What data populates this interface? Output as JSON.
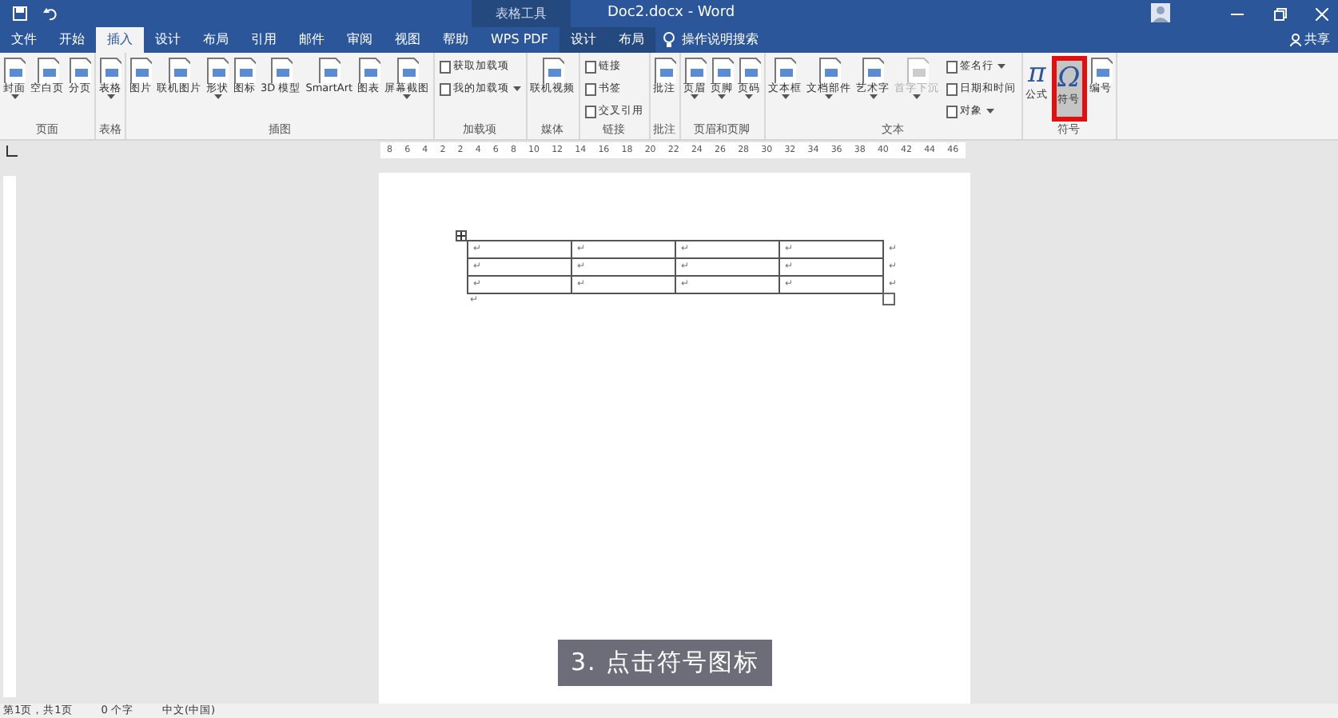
{
  "window": {
    "title": "Doc2.docx - Word",
    "context_label": "表格工具"
  },
  "tabs": [
    {
      "label": "文件",
      "selected": false,
      "context": false
    },
    {
      "label": "开始",
      "selected": false,
      "context": false
    },
    {
      "label": "插入",
      "selected": true,
      "context": false
    },
    {
      "label": "设计",
      "selected": false,
      "context": false
    },
    {
      "label": "布局",
      "selected": false,
      "context": false
    },
    {
      "label": "引用",
      "selected": false,
      "context": false
    },
    {
      "label": "邮件",
      "selected": false,
      "context": false
    },
    {
      "label": "审阅",
      "selected": false,
      "context": false
    },
    {
      "label": "视图",
      "selected": false,
      "context": false
    },
    {
      "label": "帮助",
      "selected": false,
      "context": false
    },
    {
      "label": "WPS PDF",
      "selected": false,
      "context": false
    },
    {
      "label": "设计",
      "selected": false,
      "context": true
    },
    {
      "label": "布局",
      "selected": false,
      "context": true
    }
  ],
  "search": {
    "placeholder": "操作说明搜索"
  },
  "share": "共享",
  "ribbon": [
    {
      "label": "页面",
      "buttons": [
        {
          "kind": "large",
          "label": "封面",
          "dropdown": true,
          "disabled": false
        },
        {
          "kind": "large",
          "label": "空白页",
          "dropdown": false,
          "disabled": false
        },
        {
          "kind": "large",
          "label": "分页",
          "dropdown": false,
          "disabled": false
        }
      ]
    },
    {
      "label": "表格",
      "buttons": [
        {
          "kind": "large",
          "label": "表格",
          "dropdown": true,
          "disabled": false
        }
      ]
    },
    {
      "label": "插图",
      "buttons": [
        {
          "kind": "large",
          "label": "图片",
          "dropdown": false,
          "disabled": false
        },
        {
          "kind": "large",
          "label": "联机图片",
          "dropdown": false,
          "disabled": false
        },
        {
          "kind": "large",
          "label": "形状",
          "dropdown": true,
          "disabled": false
        },
        {
          "kind": "large",
          "label": "图标",
          "dropdown": false,
          "disabled": false
        },
        {
          "kind": "large",
          "label": "3D 模型",
          "dropdown": false,
          "disabled": false
        },
        {
          "kind": "large",
          "label": "SmartArt",
          "dropdown": false,
          "disabled": false
        },
        {
          "kind": "large",
          "label": "图表",
          "dropdown": false,
          "disabled": false
        },
        {
          "kind": "large",
          "label": "屏幕截图",
          "dropdown": true,
          "disabled": false
        }
      ]
    },
    {
      "label": "加载项",
      "buttons": [
        {
          "kind": "small",
          "label": "获取加载项",
          "dropdown": false,
          "disabled": false
        },
        {
          "kind": "small",
          "label": "我的加载项",
          "dropdown": true,
          "disabled": false
        }
      ]
    },
    {
      "label": "媒体",
      "buttons": [
        {
          "kind": "large",
          "label": "联机视频",
          "dropdown": false,
          "disabled": false
        }
      ]
    },
    {
      "label": "链接",
      "buttons": [
        {
          "kind": "small",
          "label": "链接",
          "dropdown": false,
          "disabled": false
        },
        {
          "kind": "small",
          "label": "书签",
          "dropdown": false,
          "disabled": false
        },
        {
          "kind": "small",
          "label": "交叉引用",
          "dropdown": false,
          "disabled": false
        }
      ]
    },
    {
      "label": "批注",
      "buttons": [
        {
          "kind": "large",
          "label": "批注",
          "dropdown": false,
          "disabled": false
        }
      ]
    },
    {
      "label": "页眉和页脚",
      "buttons": [
        {
          "kind": "large",
          "label": "页眉",
          "dropdown": true,
          "disabled": false
        },
        {
          "kind": "large",
          "label": "页脚",
          "dropdown": true,
          "disabled": false
        },
        {
          "kind": "large",
          "label": "页码",
          "dropdown": true,
          "disabled": false
        }
      ]
    },
    {
      "label": "文本",
      "buttons": [
        {
          "kind": "large",
          "label": "文本框",
          "dropdown": true,
          "disabled": false
        },
        {
          "kind": "large",
          "label": "文档部件",
          "dropdown": true,
          "disabled": false
        },
        {
          "kind": "large",
          "label": "艺术字",
          "dropdown": true,
          "disabled": false
        },
        {
          "kind": "large",
          "label": "首字下沉",
          "dropdown": true,
          "disabled": true
        },
        {
          "kind": "small",
          "label": "签名行",
          "dropdown": true,
          "disabled": false
        },
        {
          "kind": "small",
          "label": "日期和时间",
          "dropdown": false,
          "disabled": false
        },
        {
          "kind": "small",
          "label": "对象",
          "dropdown": true,
          "disabled": false
        }
      ]
    },
    {
      "label": "符号",
      "buttons": [
        {
          "kind": "glyph",
          "glyph": "π",
          "label": "公式",
          "dropdown": false,
          "disabled": false,
          "hovered": false,
          "highlighted": false
        },
        {
          "kind": "glyph",
          "glyph": "Ω",
          "label": "符号",
          "dropdown": false,
          "disabled": false,
          "hovered": true,
          "highlighted": true
        },
        {
          "kind": "large",
          "label": "编号",
          "dropdown": false,
          "disabled": false,
          "hovered": false,
          "highlighted": false
        }
      ]
    }
  ],
  "ruler": [
    "8",
    "6",
    "4",
    "2",
    "2",
    "4",
    "6",
    "8",
    "10",
    "12",
    "14",
    "16",
    "18",
    "20",
    "22",
    "24",
    "26",
    "28",
    "30",
    "32",
    "34",
    "36",
    "38",
    "40",
    "42",
    "44",
    "46"
  ],
  "table": {
    "rows": [
      [
        "↵",
        "↵",
        "↵",
        "↵"
      ],
      [
        "↵",
        "↵",
        "↵",
        "↵"
      ],
      [
        "↵",
        "↵",
        "↵",
        "↵"
      ]
    ],
    "row_end_mark": "↵",
    "after_mark": "↵"
  },
  "caption": "3. 点击符号图标",
  "status_bar": [
    "第1页，共1页",
    "0 个字",
    "中文(中国)"
  ]
}
